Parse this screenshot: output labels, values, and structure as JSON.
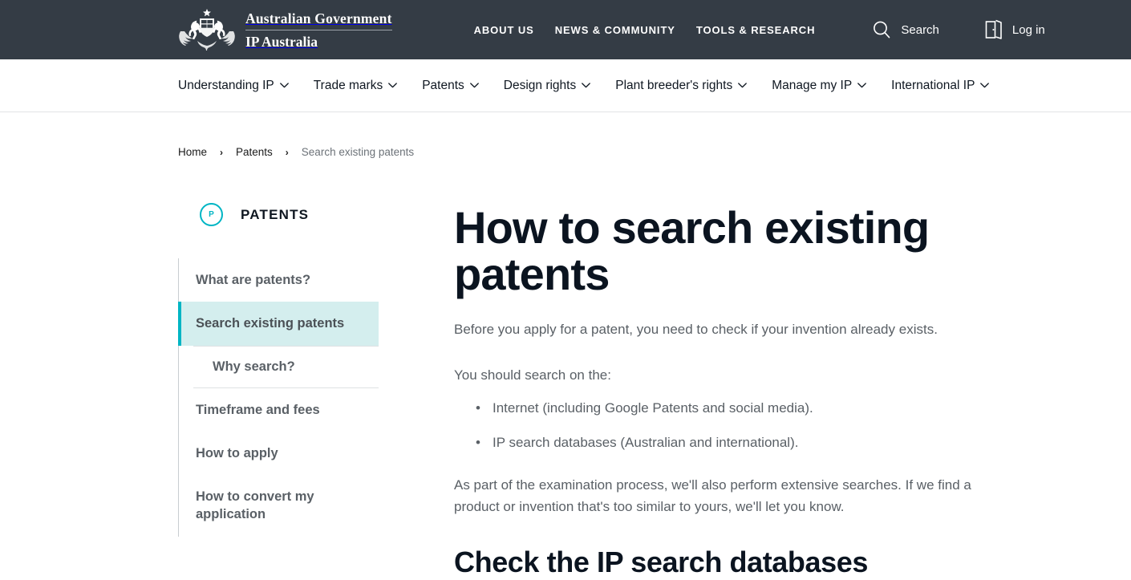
{
  "header": {
    "brand": {
      "line1": "Australian Government",
      "line2": "IP Australia",
      "crest_icon": "australian-coat-of-arms"
    },
    "util_links": [
      {
        "label": "ABOUT US"
      },
      {
        "label": "NEWS & COMMUNITY"
      },
      {
        "label": "TOOLS & RESEARCH"
      }
    ],
    "actions": [
      {
        "label": "Search",
        "icon": "search-icon"
      },
      {
        "label": "Log in",
        "icon": "door-login-icon"
      }
    ],
    "background_color": "#343c45"
  },
  "main_nav": {
    "items": [
      {
        "label": "Understanding IP",
        "has_dropdown": true
      },
      {
        "label": "Trade marks",
        "has_dropdown": true
      },
      {
        "label": "Patents",
        "has_dropdown": true
      },
      {
        "label": "Design rights",
        "has_dropdown": true
      },
      {
        "label": "Plant breeder's rights",
        "has_dropdown": true
      },
      {
        "label": "Manage my IP",
        "has_dropdown": true
      },
      {
        "label": "International IP",
        "has_dropdown": true
      }
    ]
  },
  "breadcrumb": {
    "items": [
      {
        "label": "Home",
        "current": false
      },
      {
        "label": "Patents",
        "current": false
      },
      {
        "label": "Search existing patents",
        "current": true
      }
    ],
    "separator": "›"
  },
  "sidebar": {
    "badge": "P",
    "title": "PATENTS",
    "accent_color": "#00b5c4",
    "active_background": "#d4eeee",
    "items": [
      {
        "label": "What are patents?",
        "active": false,
        "sub": false
      },
      {
        "label": "Search existing patents",
        "active": true,
        "sub": false
      },
      {
        "label": "Why search?",
        "active": false,
        "sub": true
      },
      {
        "label": "Timeframe and fees",
        "active": false,
        "sub": false
      },
      {
        "label": "How to apply",
        "active": false,
        "sub": false
      },
      {
        "label": "How to convert my application",
        "active": false,
        "sub": false
      }
    ]
  },
  "main": {
    "title": "How to search existing patents",
    "lead": "Before you apply for a patent, you need to check if your invention already exists.",
    "intro": "You should search on the:",
    "bullets": [
      "Internet (including Google Patents and social media).",
      "IP search databases (Australian and international)."
    ],
    "paragraph": "As part of the examination process, we'll also perform extensive searches. If we find a product or invention that's too similar to yours, we'll let you know.",
    "section_title": "Check the IP search databases"
  }
}
